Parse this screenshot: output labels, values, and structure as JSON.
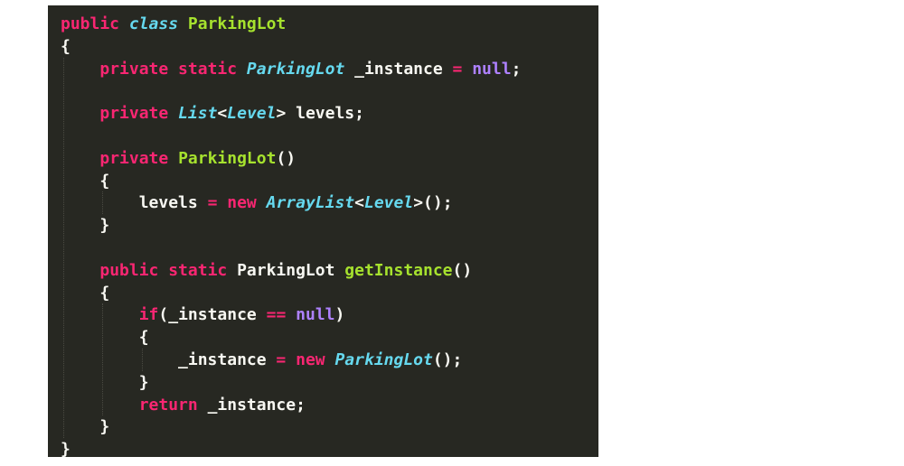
{
  "editor": {
    "background": "#272822",
    "theme_colors": {
      "keyword": "#f92672",
      "type": "#66d9ef",
      "function": "#a6e22e",
      "literal": "#ae81ff",
      "plain": "#f8f8f2"
    },
    "lines": [
      [
        {
          "t": "public ",
          "c": "kw"
        },
        {
          "t": "class",
          "c": "ty"
        },
        {
          "t": " ",
          "c": "pl"
        },
        {
          "t": "ParkingLot",
          "c": "fn"
        }
      ],
      [
        {
          "t": "{",
          "c": "pl"
        }
      ],
      [
        {
          "t": "    ",
          "c": "pl"
        },
        {
          "t": "private static ",
          "c": "kw"
        },
        {
          "t": "ParkingLot",
          "c": "ty"
        },
        {
          "t": " _instance ",
          "c": "pl"
        },
        {
          "t": "=",
          "c": "kw"
        },
        {
          "t": " ",
          "c": "pl"
        },
        {
          "t": "null",
          "c": "lit"
        },
        {
          "t": ";",
          "c": "pl"
        }
      ],
      [],
      [
        {
          "t": "    ",
          "c": "pl"
        },
        {
          "t": "private ",
          "c": "kw"
        },
        {
          "t": "List",
          "c": "ty"
        },
        {
          "t": "<",
          "c": "pl"
        },
        {
          "t": "Level",
          "c": "ty"
        },
        {
          "t": "> levels;",
          "c": "pl"
        }
      ],
      [],
      [
        {
          "t": "    ",
          "c": "pl"
        },
        {
          "t": "private ",
          "c": "kw"
        },
        {
          "t": "ParkingLot",
          "c": "fn"
        },
        {
          "t": "()",
          "c": "pl"
        }
      ],
      [
        {
          "t": "    {",
          "c": "pl"
        }
      ],
      [
        {
          "t": "        levels ",
          "c": "pl"
        },
        {
          "t": "=",
          "c": "kw"
        },
        {
          "t": " ",
          "c": "pl"
        },
        {
          "t": "new",
          "c": "kw"
        },
        {
          "t": " ",
          "c": "pl"
        },
        {
          "t": "ArrayList",
          "c": "ty"
        },
        {
          "t": "<",
          "c": "pl"
        },
        {
          "t": "Level",
          "c": "ty"
        },
        {
          "t": ">();",
          "c": "pl"
        }
      ],
      [
        {
          "t": "    }",
          "c": "pl"
        }
      ],
      [],
      [
        {
          "t": "    ",
          "c": "pl"
        },
        {
          "t": "public static ",
          "c": "kw"
        },
        {
          "t": "ParkingLot ",
          "c": "pl"
        },
        {
          "t": "getInstance",
          "c": "fn"
        },
        {
          "t": "()",
          "c": "pl"
        }
      ],
      [
        {
          "t": "    {",
          "c": "pl"
        }
      ],
      [
        {
          "t": "        ",
          "c": "pl"
        },
        {
          "t": "if",
          "c": "kw"
        },
        {
          "t": "(_instance ",
          "c": "pl"
        },
        {
          "t": "==",
          "c": "kw"
        },
        {
          "t": " ",
          "c": "pl"
        },
        {
          "t": "null",
          "c": "lit"
        },
        {
          "t": ")",
          "c": "pl"
        }
      ],
      [
        {
          "t": "        {",
          "c": "pl"
        }
      ],
      [
        {
          "t": "            _instance ",
          "c": "pl"
        },
        {
          "t": "=",
          "c": "kw"
        },
        {
          "t": " ",
          "c": "pl"
        },
        {
          "t": "new",
          "c": "kw"
        },
        {
          "t": " ",
          "c": "pl"
        },
        {
          "t": "ParkingLot",
          "c": "ty"
        },
        {
          "t": "();",
          "c": "pl"
        }
      ],
      [
        {
          "t": "        }",
          "c": "pl"
        }
      ],
      [
        {
          "t": "        ",
          "c": "pl"
        },
        {
          "t": "return",
          "c": "kw"
        },
        {
          "t": " _instance;",
          "c": "pl"
        }
      ],
      [
        {
          "t": "    }",
          "c": "pl"
        }
      ],
      [
        {
          "t": "}",
          "c": "pl"
        }
      ]
    ]
  }
}
